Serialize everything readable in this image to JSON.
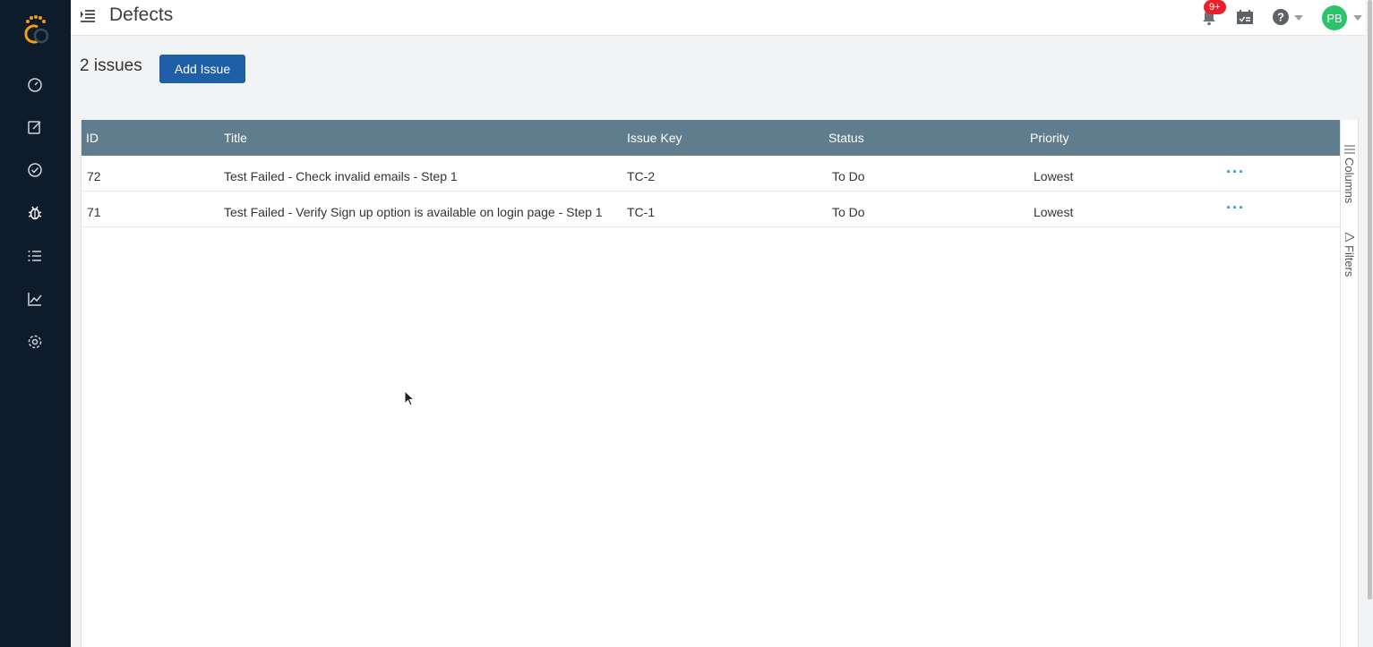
{
  "app": {
    "brand_color": "#f39c12",
    "sidebar_color": "#0d1b2a"
  },
  "sidebar": {
    "items": [
      {
        "name": "dashboard",
        "icon": "gauge-icon"
      },
      {
        "name": "test-cases",
        "icon": "edit-icon"
      },
      {
        "name": "test-runs",
        "icon": "check-circle-icon"
      },
      {
        "name": "defects",
        "icon": "bug-icon"
      },
      {
        "name": "requirements",
        "icon": "list-icon"
      },
      {
        "name": "reports",
        "icon": "chart-icon"
      },
      {
        "name": "settings",
        "icon": "gear-icon"
      }
    ]
  },
  "header": {
    "title": "Defects",
    "notification_badge": "9+",
    "avatar_initials": "PB"
  },
  "toolbar": {
    "issue_count": "2 issues",
    "add_issue_label": "Add Issue"
  },
  "table": {
    "columns": [
      "ID",
      "Title",
      "Issue Key",
      "Status",
      "Priority"
    ],
    "rows": [
      {
        "id": "72",
        "title": "Test Failed - Check invalid emails - Step 1",
        "issue_key": "TC-2",
        "status": "To Do",
        "priority": "Lowest",
        "actions": "···"
      },
      {
        "id": "71",
        "title": "Test Failed - Verify Sign up option is available on login page - Step 1",
        "issue_key": "TC-1",
        "status": "To Do",
        "priority": "Lowest",
        "actions": "···"
      }
    ]
  },
  "side_panel": {
    "columns_label": "Columns",
    "filters_label": "Filters"
  }
}
